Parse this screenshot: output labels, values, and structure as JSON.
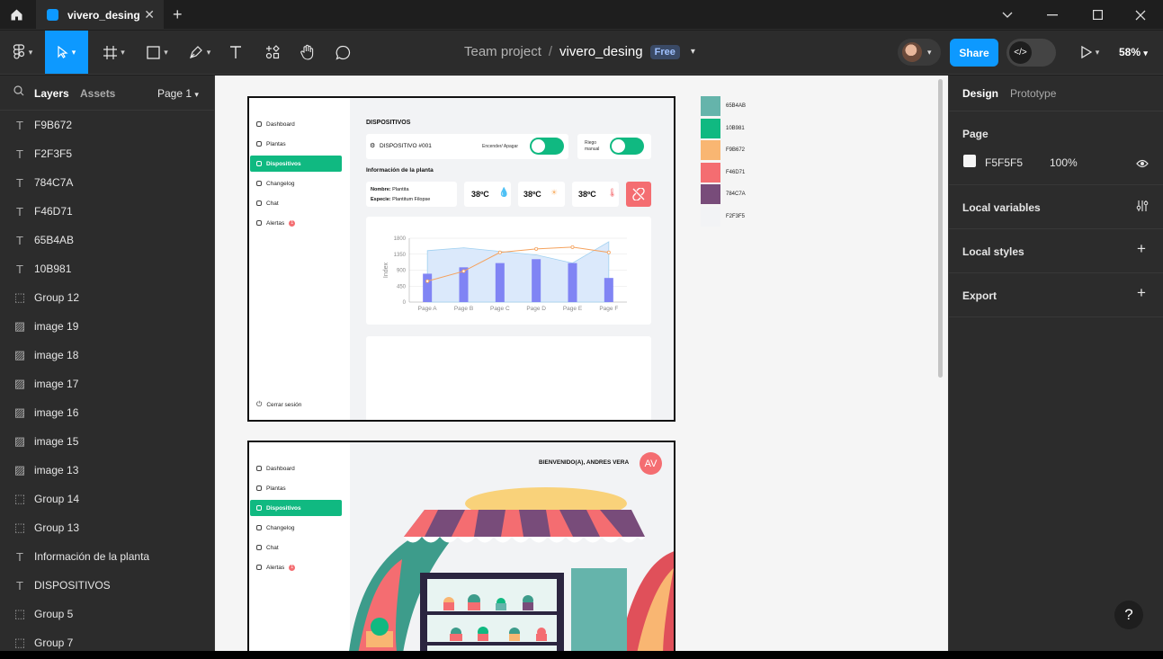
{
  "titlebar": {
    "file_tab": "vivero_desing",
    "new_tab": "+"
  },
  "toolbar": {
    "team": "Team project",
    "separator": "/",
    "file": "vivero_desing",
    "plan_badge": "Free",
    "share": "Share",
    "zoom": "58%"
  },
  "left_panel": {
    "tabs": {
      "layers": "Layers",
      "assets": "Assets",
      "page": "Page 1"
    },
    "layers": [
      {
        "type": "text",
        "name": "F9B672"
      },
      {
        "type": "text",
        "name": "F2F3F5"
      },
      {
        "type": "text",
        "name": "784C7A"
      },
      {
        "type": "text",
        "name": "F46D71"
      },
      {
        "type": "text",
        "name": "65B4AB"
      },
      {
        "type": "text",
        "name": "10B981"
      },
      {
        "type": "group",
        "name": "Group 12"
      },
      {
        "type": "image",
        "name": "image 19"
      },
      {
        "type": "image",
        "name": "image 18"
      },
      {
        "type": "image",
        "name": "image 17"
      },
      {
        "type": "image",
        "name": "image 16"
      },
      {
        "type": "image",
        "name": "image 15"
      },
      {
        "type": "image",
        "name": "image 13"
      },
      {
        "type": "group",
        "name": "Group 14"
      },
      {
        "type": "group",
        "name": "Group 13"
      },
      {
        "type": "text",
        "name": "Información de la planta"
      },
      {
        "type": "text",
        "name": "DISPOSITIVOS"
      },
      {
        "type": "group",
        "name": "Group 5"
      },
      {
        "type": "group",
        "name": "Group 7"
      }
    ]
  },
  "right_panel": {
    "tabs": {
      "design": "Design",
      "prototype": "Prototype"
    },
    "page_title": "Page",
    "page_color": "F5F5F5",
    "page_opacity": "100%",
    "local_variables": "Local variables",
    "local_styles": "Local styles",
    "export": "Export",
    "help": "?"
  },
  "canvas": {
    "swatches": [
      {
        "hex": "#65B4AB",
        "label": "65B4AB"
      },
      {
        "hex": "#10B981",
        "label": "10B981"
      },
      {
        "hex": "#F9B672",
        "label": "F9B672"
      },
      {
        "hex": "#F46D71",
        "label": "F46D71"
      },
      {
        "hex": "#784C7A",
        "label": "784C7A"
      },
      {
        "hex": "#F2F3F5",
        "label": "F2F3F5"
      }
    ],
    "frame1": {
      "nav": [
        "Dashboard",
        "Plantas",
        "Dispositivos",
        "Changelog",
        "Chat",
        "Alertas"
      ],
      "alert_count": "1",
      "logout": "Cerrar sesión",
      "heading": "DISPOSITIVOS",
      "device_label": "DISPOSITIVO",
      "device_id": "#001",
      "power_label": "Encender/ Apagar",
      "irrigation_label_1": "Riego",
      "irrigation_label_2": "manual",
      "plant_info_title": "Información de la planta",
      "name_label": "Nombre:",
      "name_value": "Plantita",
      "species_label": "Especie:",
      "species_value": "Plantitum Filopse",
      "readings": [
        "38ºC",
        "38ºC",
        "38ºC"
      ]
    },
    "frame2": {
      "nav": [
        "Dashboard",
        "Plantas",
        "Dispositivos",
        "Changelog",
        "Chat",
        "Alertas"
      ],
      "alert_count": "1",
      "welcome": "BIENVENIDO(A), ANDRES VERA",
      "avatar_initials": "AV"
    }
  },
  "chart_data": {
    "type": "bar",
    "categories": [
      "Page A",
      "Page B",
      "Page C",
      "Page D",
      "Page E",
      "Page F"
    ],
    "ylabel": "Index",
    "ylim": [
      0,
      1800
    ],
    "yticks": [
      0,
      450,
      900,
      1350,
      1800
    ],
    "series": [
      {
        "kind": "bar",
        "values": [
          800,
          980,
          1100,
          1210,
          1100,
          680
        ],
        "color": "#8084f4"
      },
      {
        "kind": "area",
        "values": [
          1450,
          1530,
          1430,
          1330,
          1100,
          1700
        ],
        "color": "#9fd0f0"
      },
      {
        "kind": "line",
        "values": [
          590,
          870,
          1400,
          1500,
          1550,
          1400
        ],
        "color": "#f5a25d"
      }
    ]
  }
}
